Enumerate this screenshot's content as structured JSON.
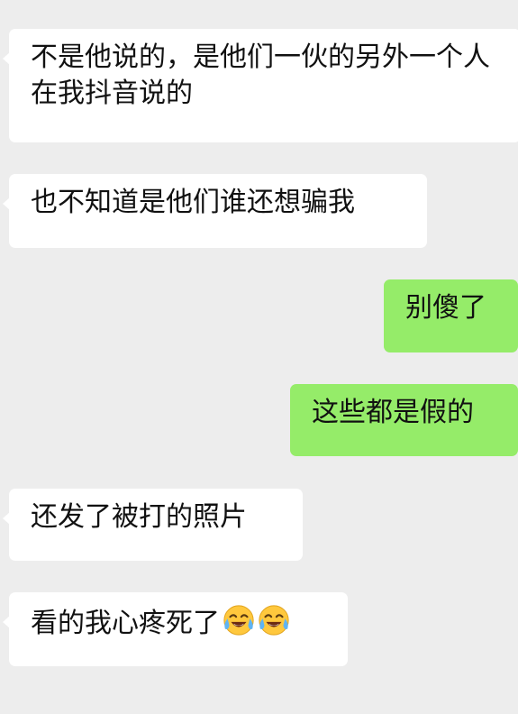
{
  "chat": {
    "messages": [
      {
        "id": "m1",
        "side": "incoming",
        "text": "不是他说的，是他们一伙的另外一个人在我抖音说的"
      },
      {
        "id": "m2",
        "side": "incoming",
        "text": "也不知道是他们谁还想骗我"
      },
      {
        "id": "m3",
        "side": "outgoing",
        "text": "别傻了"
      },
      {
        "id": "m4",
        "side": "outgoing",
        "text": "这些都是假的"
      },
      {
        "id": "m5",
        "side": "incoming",
        "text": "还发了被打的照片"
      },
      {
        "id": "m6",
        "side": "incoming",
        "text": "看的我心疼死了",
        "emojis": [
          "tears-of-joy-emoji",
          "tears-of-joy-emoji"
        ]
      }
    ]
  },
  "colors": {
    "background": "#ededed",
    "incoming_bubble": "#ffffff",
    "outgoing_bubble": "#95ec69",
    "text": "#111111"
  }
}
